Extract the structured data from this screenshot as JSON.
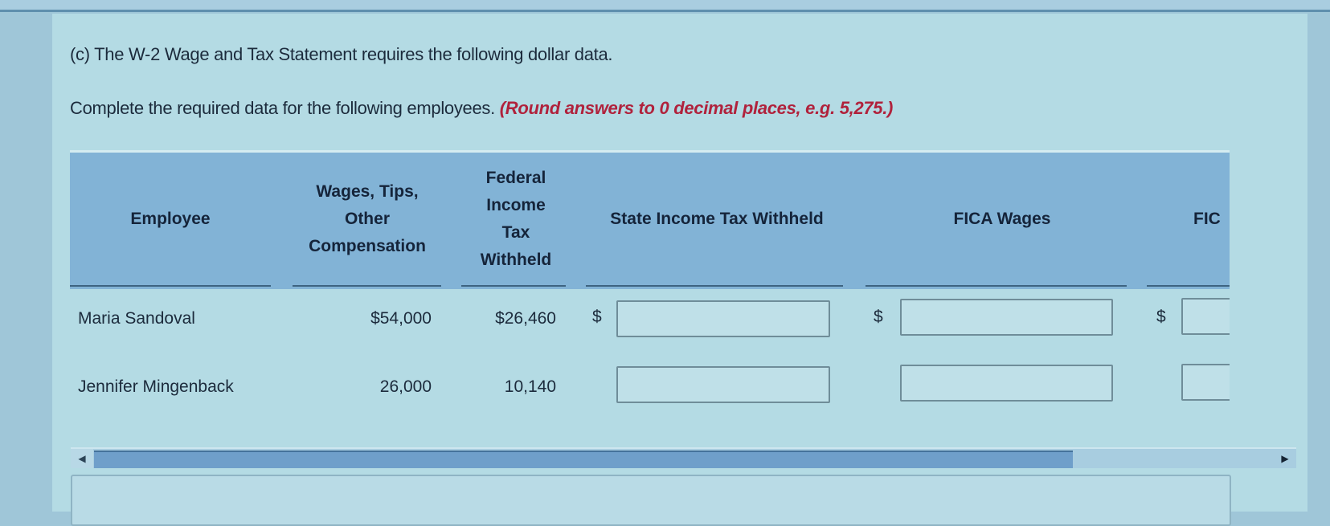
{
  "question": {
    "text": "(c) The W-2 Wage and Tax Statement requires the following dollar data."
  },
  "instructions": {
    "text": "Complete the required data for the following employees.",
    "hint": "(Round answers to 0 decimal places, e.g. 5,275.)"
  },
  "table": {
    "headers": {
      "employee": "Employee",
      "wages_line1": "Wages, Tips,",
      "wages_line2": "Other",
      "wages_line3": "Compensation",
      "federal_line1": "Federal",
      "federal_line2": "Income",
      "federal_line3": "Tax",
      "federal_line4": "Withheld",
      "state": "State Income Tax Withheld",
      "fica_wages": "FICA Wages",
      "fica_truncated": "FIC"
    },
    "currency_symbol": "$",
    "rows": [
      {
        "employee": "Maria Sandoval",
        "wages": "$54,000",
        "federal_withheld": "$26,460",
        "state_withheld": "",
        "fica_wages": "",
        "fica_withheld": ""
      },
      {
        "employee": "Jennifer Mingenback",
        "wages": "26,000",
        "federal_withheld": "10,140",
        "state_withheld": "",
        "fica_wages": "",
        "fica_withheld": ""
      }
    ]
  },
  "scrollbar": {
    "left_arrow": "◀",
    "right_arrow": "▶",
    "thumb_fraction": 0.83
  }
}
